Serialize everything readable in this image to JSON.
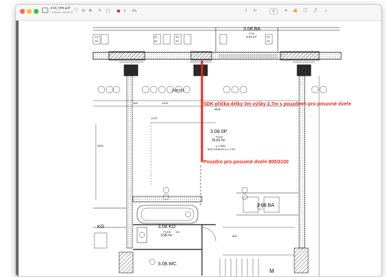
{
  "app": {
    "document_title": "3-05_NR5.pdf",
    "document_subtitle": "1 stránka • Upraveno"
  },
  "toolbar": {
    "sidebar_icon": "sidebar-icon",
    "info_icon": "info-icon",
    "zoom_out_icon": "zoom-out-icon",
    "zoom_in_icon": "zoom-in-icon",
    "share_icon": "share-icon",
    "highlight_icon": "highlight-icon",
    "markup_icon": "pen-icon",
    "shape_icon": "shape-icon",
    "color_icon": "color-swatch-icon",
    "text_style_label": "Aa",
    "accent_color": "#e0301e"
  },
  "plan": {
    "room_top": {
      "code": "3.08.BA",
      "sub": "P.18",
      "area": "3,04 m²"
    },
    "room_main": {
      "code": "3.08.0P",
      "sub": "P.01A",
      "area": "35,81 m²",
      "note1": "s.v. 2800",
      "note2": "SDK PODHLED s.v. 2700"
    },
    "room_ko": {
      "code": "3.08.KO",
      "sub": "P.01B",
      "area": "3,96 m²"
    },
    "room_wc": {
      "code": "3.08.WC"
    },
    "room_m": {
      "code": "M"
    },
    "room_ko_side": {
      "code": "KO"
    },
    "tags_row1": [
      "K1",
      "02",
      "01",
      "02",
      "01",
      "02",
      "K1",
      "02"
    ],
    "dims": [
      "165",
      "2400",
      "5835",
      "2270",
      "4500",
      "1500",
      "1600",
      "1170",
      "2400"
    ],
    "door_tag": "800",
    "door_tag2": "D4"
  },
  "annotations": {
    "text1": "SDK příčka délky 3m  výšky 2,7m s pouzdrem pro posuvné dveře",
    "text2": "Pouzdro pro posuvné dveře 800/2100",
    "color": "#e8261a"
  }
}
